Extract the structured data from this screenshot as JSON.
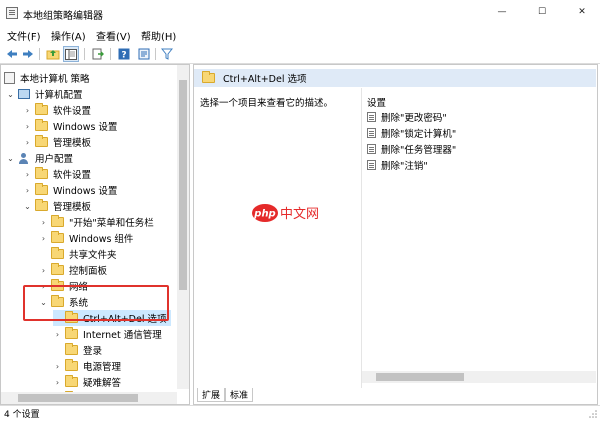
{
  "window": {
    "title": "本地组策略编辑器",
    "controls": {
      "minimize": "—",
      "maximize": "☐",
      "close": "✕"
    }
  },
  "menu": [
    {
      "label": "文件(F)"
    },
    {
      "label": "操作(A)"
    },
    {
      "label": "查看(V)"
    },
    {
      "label": "帮助(H)"
    }
  ],
  "toolbar": {
    "icons": [
      "back-arrow-icon",
      "forward-arrow-icon",
      "up-folder-icon",
      "show-hide-tree-icon",
      "export-list-icon",
      "help-icon",
      "properties-icon",
      "filter-icon"
    ]
  },
  "tree": {
    "rows": [
      {
        "label": "本地计算机 策略"
      },
      {
        "label": "计算机配置"
      },
      {
        "label": "软件设置"
      },
      {
        "label": "Windows 设置"
      },
      {
        "label": "管理模板"
      },
      {
        "label": "用户配置"
      },
      {
        "label": "软件设置"
      },
      {
        "label": "Windows 设置"
      },
      {
        "label": "管理模板"
      },
      {
        "label": "\"开始\"菜单和任务栏"
      },
      {
        "label": "Windows 组件"
      },
      {
        "label": "共享文件夹"
      },
      {
        "label": "控制面板"
      },
      {
        "label": "网络"
      },
      {
        "label": "系统"
      },
      {
        "label": "Ctrl+Alt+Del 选项"
      },
      {
        "label": "Internet 通信管理"
      },
      {
        "label": "登录"
      },
      {
        "label": "电源管理"
      },
      {
        "label": "疑难解答"
      },
      {
        "label": "脚本"
      }
    ]
  },
  "right": {
    "header": "Ctrl+Alt+Del 选项",
    "description": "选择一个项目来查看它的描述。",
    "settings_heading": "设置",
    "settings": [
      {
        "label": "删除\"更改密码\""
      },
      {
        "label": "删除\"锁定计算机\""
      },
      {
        "label": "删除\"任务管理器\""
      },
      {
        "label": "删除\"注销\""
      }
    ],
    "tabs": {
      "extended": "扩展",
      "standard": "标准"
    }
  },
  "watermark": {
    "brand": "php",
    "text": "中文网"
  },
  "status": {
    "text": "4 个设置"
  },
  "colors": {
    "selection": "#cce8ff",
    "highlight_box": "#e0322c",
    "header_bg": "#dfeaf7",
    "folder": "#f8d775"
  }
}
